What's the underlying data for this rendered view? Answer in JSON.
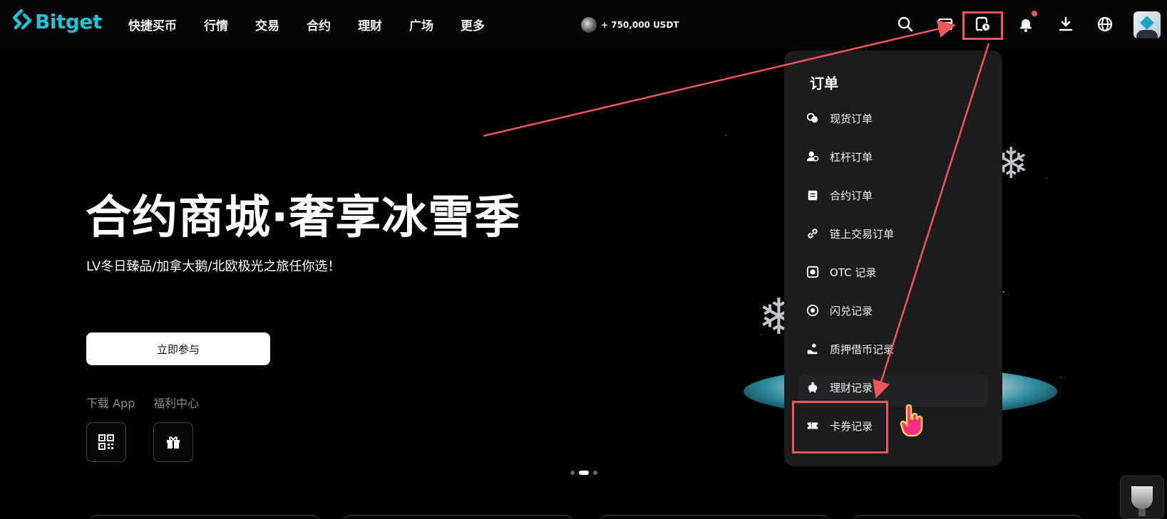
{
  "header": {
    "logo_text": "Bitget",
    "nav": [
      "快捷买币",
      "行情",
      "交易",
      "合约",
      "理财",
      "广场",
      "更多"
    ],
    "promo_text": "+ 750,000 USDT",
    "icons": [
      "search-icon",
      "wallet-icon",
      "orders-icon",
      "bell-icon",
      "download-icon",
      "globe-icon"
    ]
  },
  "hero": {
    "title": "合约商城·奢享冰雪季",
    "subtitle": "LV冬日臻品/加拿大鹅/北欧极光之旅任你选！",
    "cta_label": "立即参与",
    "quick_links": [
      {
        "label": "下载 App",
        "icon": "qr-code-icon"
      },
      {
        "label": "福利中心",
        "icon": "gift-icon"
      }
    ],
    "carousel_active_index": 1,
    "carousel_count": 3
  },
  "orders_menu": {
    "title": "订单",
    "items": [
      {
        "label": "现货订单",
        "icon": "spot-coin-icon"
      },
      {
        "label": "杠杆订单",
        "icon": "margin-user-icon"
      },
      {
        "label": "合约订单",
        "icon": "contract-doc-icon"
      },
      {
        "label": "链上交易订单",
        "icon": "chain-link-icon"
      },
      {
        "label": "OTC 记录",
        "icon": "otc-icon"
      },
      {
        "label": "闪兑记录",
        "icon": "swap-icon"
      },
      {
        "label": "质押借币记录",
        "icon": "pledge-hand-icon"
      },
      {
        "label": "理财记录",
        "icon": "piggy-bank-icon"
      },
      {
        "label": "卡券记录",
        "icon": "ticket-icon"
      }
    ]
  },
  "colors": {
    "brand": "#21c2d6",
    "annotation": "#f1555a",
    "background": "#000000",
    "menu_bg": "#1c1c1e"
  }
}
